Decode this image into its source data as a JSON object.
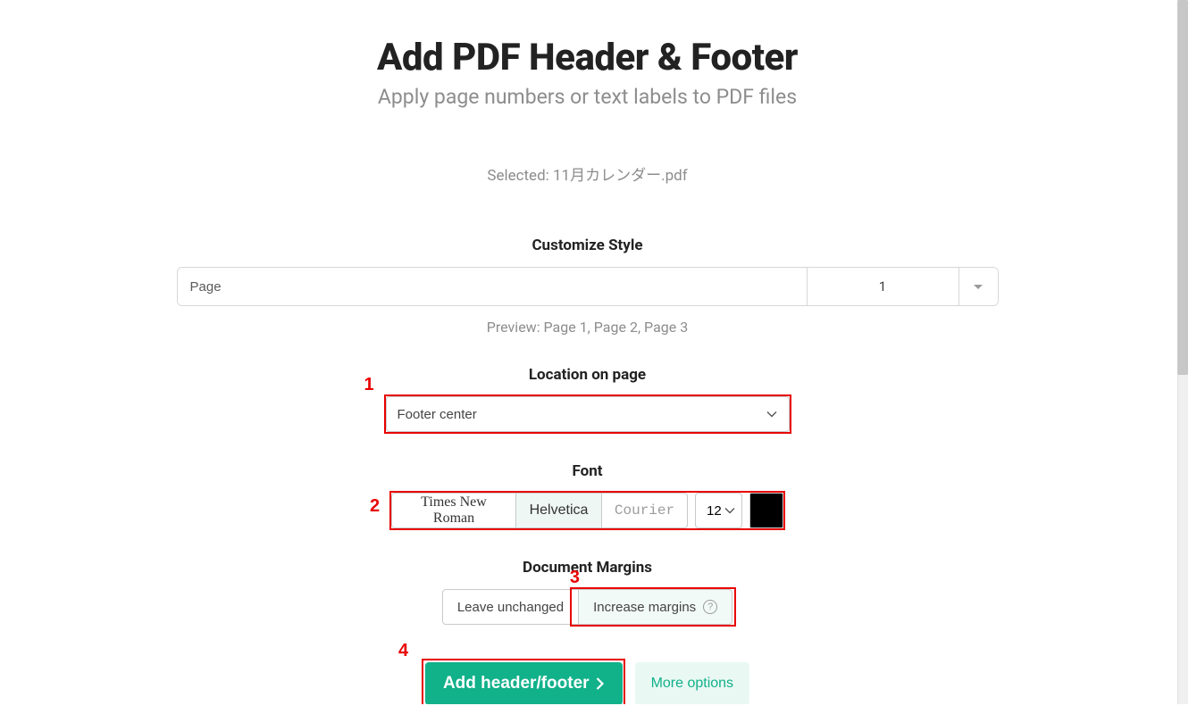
{
  "header": {
    "title": "Add PDF Header & Footer",
    "subtitle": "Apply page numbers or text labels to PDF files"
  },
  "file": {
    "selected_label": "Selected: 11月カレンダー.pdf"
  },
  "style": {
    "section_label": "Customize Style",
    "text_value": "Page",
    "start_number": "1",
    "preview": "Preview: Page 1, Page 2, Page 3"
  },
  "location": {
    "section_label": "Location on page",
    "selected": "Footer center"
  },
  "font": {
    "section_label": "Font",
    "options": {
      "tnr": "Times New Roman",
      "helv": "Helvetica",
      "cour": "Courier"
    },
    "size": "12",
    "color": "#000000"
  },
  "margins": {
    "section_label": "Document Margins",
    "leave": "Leave unchanged",
    "increase": "Increase margins"
  },
  "actions": {
    "primary": "Add header/footer",
    "more": "More options"
  },
  "annotations": {
    "n1": "1",
    "n2": "2",
    "n3": "3",
    "n4": "4"
  }
}
